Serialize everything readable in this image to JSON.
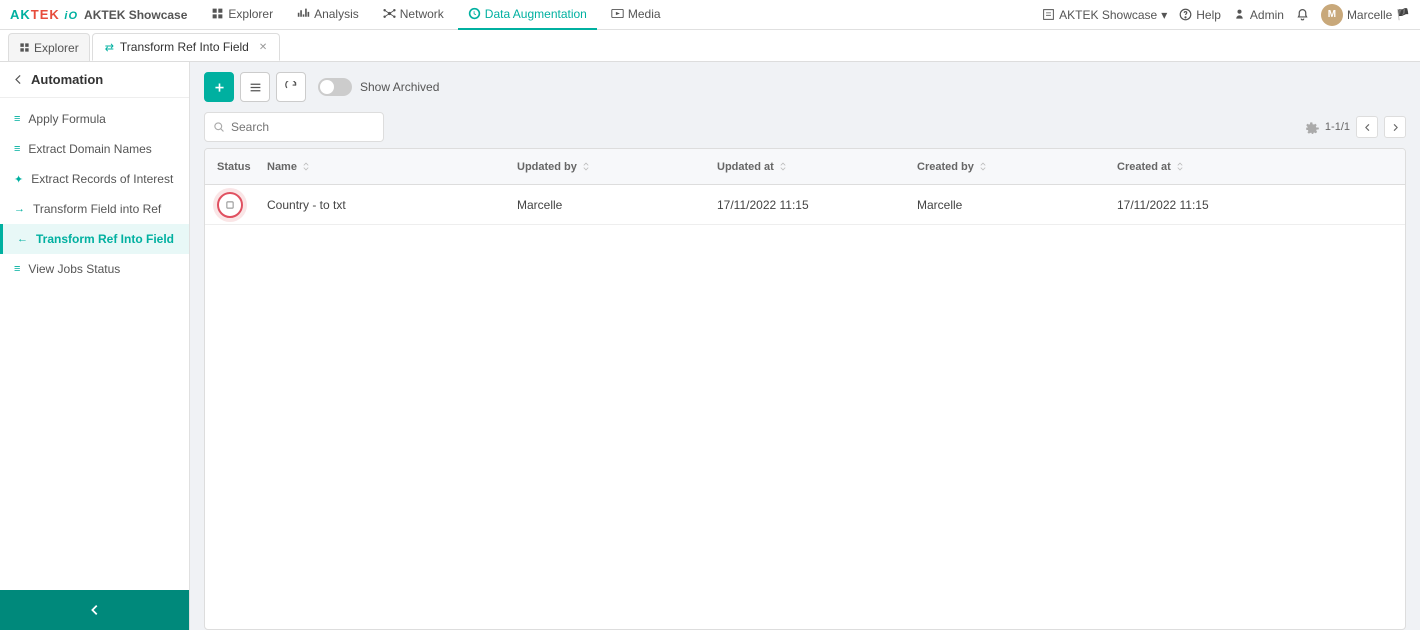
{
  "brand": {
    "logo_ak": "AK",
    "logo_tek": "TEK",
    "logo_io": "iO",
    "name": "AKTEK Showcase"
  },
  "topnav": {
    "items": [
      {
        "id": "explorer",
        "label": "Explorer",
        "icon": "folder-icon"
      },
      {
        "id": "analysis",
        "label": "Analysis",
        "icon": "chart-icon"
      },
      {
        "id": "network",
        "label": "Network",
        "icon": "network-icon"
      },
      {
        "id": "data-augmentation",
        "label": "Data Augmentation",
        "icon": "augmentation-icon",
        "active": true
      },
      {
        "id": "media",
        "label": "Media",
        "icon": "media-icon"
      }
    ],
    "right": {
      "showcase_label": "AKTEK Showcase",
      "help_label": "Help",
      "admin_label": "Admin",
      "user_label": "Marcelle",
      "user_avatar_initials": "M"
    }
  },
  "tabs": [
    {
      "id": "explorer-tab",
      "label": "Explorer",
      "icon": "explorer-icon",
      "active": false,
      "closable": false
    },
    {
      "id": "transform-ref-tab",
      "label": "Transform Ref Into Field",
      "icon": "transform-icon",
      "active": true,
      "closable": true
    }
  ],
  "sidebar": {
    "back_label": "Automation",
    "items": [
      {
        "id": "apply-formula",
        "label": "Apply Formula",
        "icon": "formula-icon",
        "active": false
      },
      {
        "id": "extract-domain-names",
        "label": "Extract Domain Names",
        "icon": "domain-icon",
        "active": false
      },
      {
        "id": "extract-records",
        "label": "Extract Records of Interest",
        "icon": "records-icon",
        "active": false
      },
      {
        "id": "transform-field-ref",
        "label": "Transform Field into Ref",
        "icon": "arrow-icon",
        "active": false
      },
      {
        "id": "transform-ref-field",
        "label": "Transform Ref Into Field",
        "icon": "arrow-back-icon",
        "active": true
      },
      {
        "id": "view-jobs",
        "label": "View Jobs Status",
        "icon": "jobs-icon",
        "active": false
      }
    ],
    "collapse_label": "Collapse"
  },
  "toolbar": {
    "add_label": "+",
    "list_icon": "list-icon",
    "refresh_icon": "refresh-icon",
    "show_archived_label": "Show Archived"
  },
  "search": {
    "placeholder": "Search"
  },
  "table": {
    "columns": [
      {
        "id": "status",
        "label": "Status"
      },
      {
        "id": "name",
        "label": "Name"
      },
      {
        "id": "updated_by",
        "label": "Updated by"
      },
      {
        "id": "updated_at",
        "label": "Updated at"
      },
      {
        "id": "created_by",
        "label": "Created by"
      },
      {
        "id": "created_at",
        "label": "Created at"
      }
    ],
    "rows": [
      {
        "status": "",
        "name": "Country - to txt",
        "updated_by": "Marcelle",
        "updated_at": "17/11/2022 11:15",
        "created_by": "Marcelle",
        "created_at": "17/11/2022 11:15"
      }
    ]
  },
  "pagination": {
    "info": "1-1/1",
    "gear_icon": "settings-icon",
    "prev_icon": "chevron-left-icon",
    "next_icon": "chevron-right-icon"
  }
}
